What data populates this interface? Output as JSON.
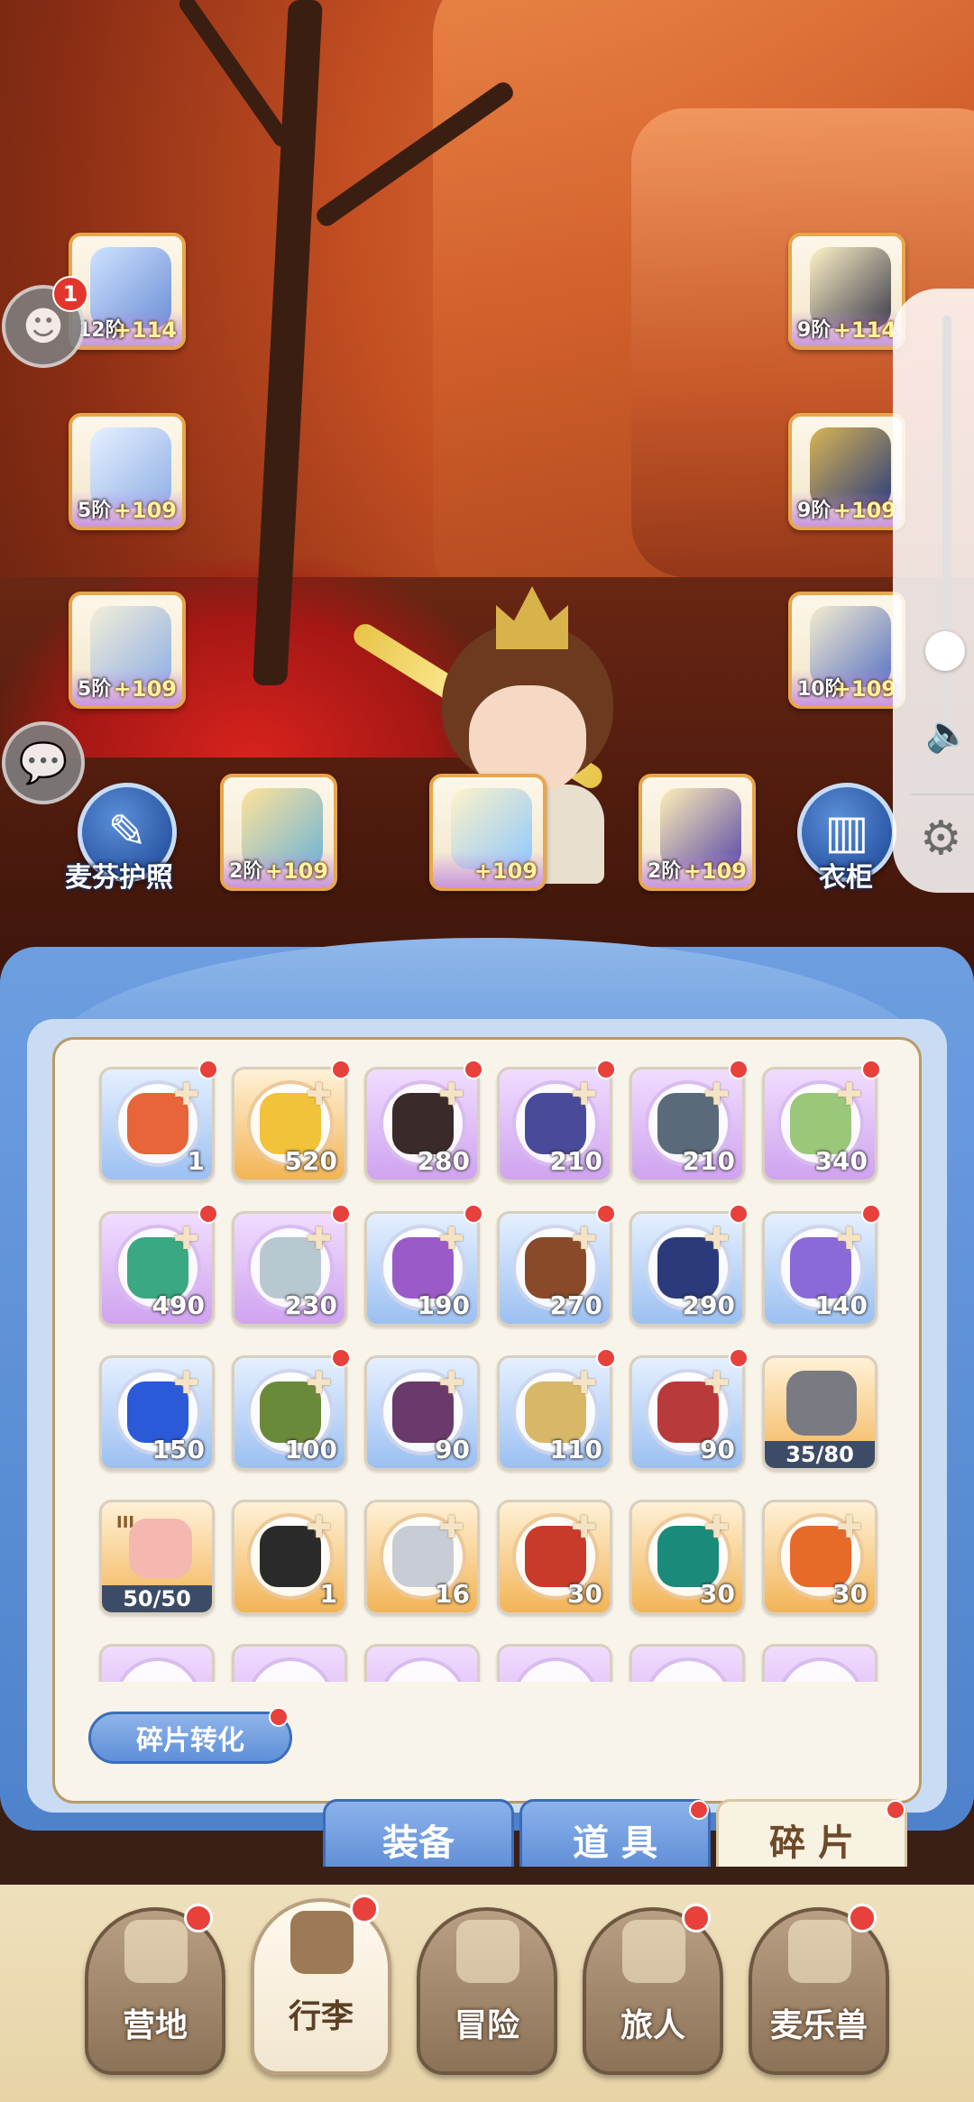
{
  "equipment": {
    "left": [
      {
        "tier": "12阶",
        "plus": "+114"
      },
      {
        "tier": "5阶",
        "plus": "+109"
      },
      {
        "tier": "5阶",
        "plus": "+109"
      }
    ],
    "right": [
      {
        "tier": "9阶",
        "plus": "+114"
      },
      {
        "tier": "9阶",
        "plus": "+109"
      },
      {
        "tier": "10阶",
        "plus": "+109"
      }
    ],
    "bottom": [
      {
        "tier": "2阶",
        "plus": "+109"
      },
      {
        "tier": "",
        "plus": "+109"
      },
      {
        "tier": "2阶",
        "plus": "+109"
      }
    ]
  },
  "passport_label": "麦芬护照",
  "wardrobe_label": "衣柜",
  "notification_count": "1",
  "convert_button_label": "碎片转化",
  "tabs": {
    "equip": "装备",
    "items": "道 具",
    "shards": "碎 片"
  },
  "nav": {
    "camp": "营地",
    "luggage": "行李",
    "adventure": "冒险",
    "traveler": "旅人",
    "beast": "麦乐兽"
  },
  "shards": [
    [
      "1",
      "520",
      "280",
      "210",
      "210",
      "340"
    ],
    [
      "490",
      "230",
      "190",
      "270",
      "290",
      "140"
    ],
    [
      "150",
      "100",
      "90",
      "110",
      "90",
      "35/80"
    ],
    [
      "50/50",
      "1",
      "16",
      "30",
      "30",
      "30"
    ]
  ],
  "special_roman": "III"
}
